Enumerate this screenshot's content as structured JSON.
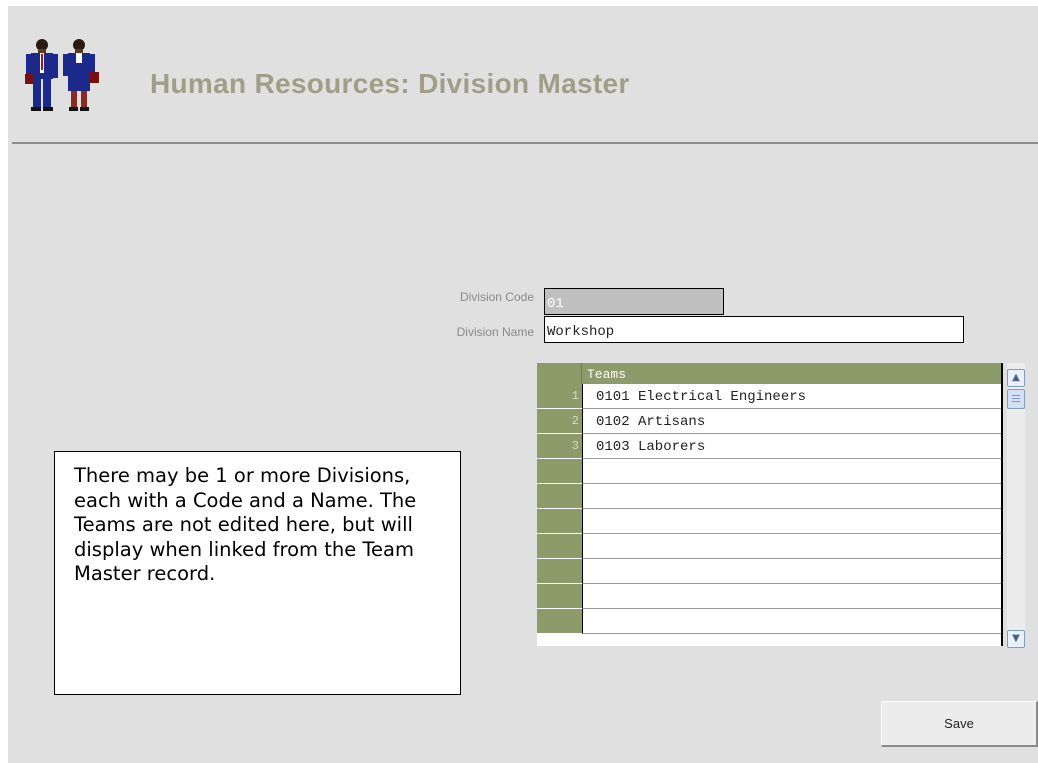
{
  "header": {
    "title": "Human Resources: Division Master",
    "logo_icon": "people-icon"
  },
  "form": {
    "division_code_label": "Division Code",
    "division_code_value": "01",
    "division_name_label": "Division Name",
    "division_name_value": "Workshop"
  },
  "teams_grid": {
    "header": "Teams",
    "rows": [
      {
        "num": "1",
        "value": "0101 Electrical Engineers"
      },
      {
        "num": "2",
        "value": "0102 Artisans"
      },
      {
        "num": "3",
        "value": "0103 Laborers"
      },
      {
        "num": "",
        "value": ""
      },
      {
        "num": "",
        "value": ""
      },
      {
        "num": "",
        "value": ""
      },
      {
        "num": "",
        "value": ""
      },
      {
        "num": "",
        "value": ""
      },
      {
        "num": "",
        "value": ""
      },
      {
        "num": "",
        "value": ""
      }
    ],
    "scroll_up_icon": "chevron-up-icon",
    "scroll_down_icon": "chevron-down-icon"
  },
  "note": {
    "text": "There may be 1 or more Divisions, each with a Code and a Name. The Teams are not edited here, but will display when linked from the Team Master record."
  },
  "actions": {
    "save_label": "Save"
  },
  "colors": {
    "grid_header": "#8d9a6a",
    "title": "#a09e86",
    "background": "#e0e0e0"
  }
}
